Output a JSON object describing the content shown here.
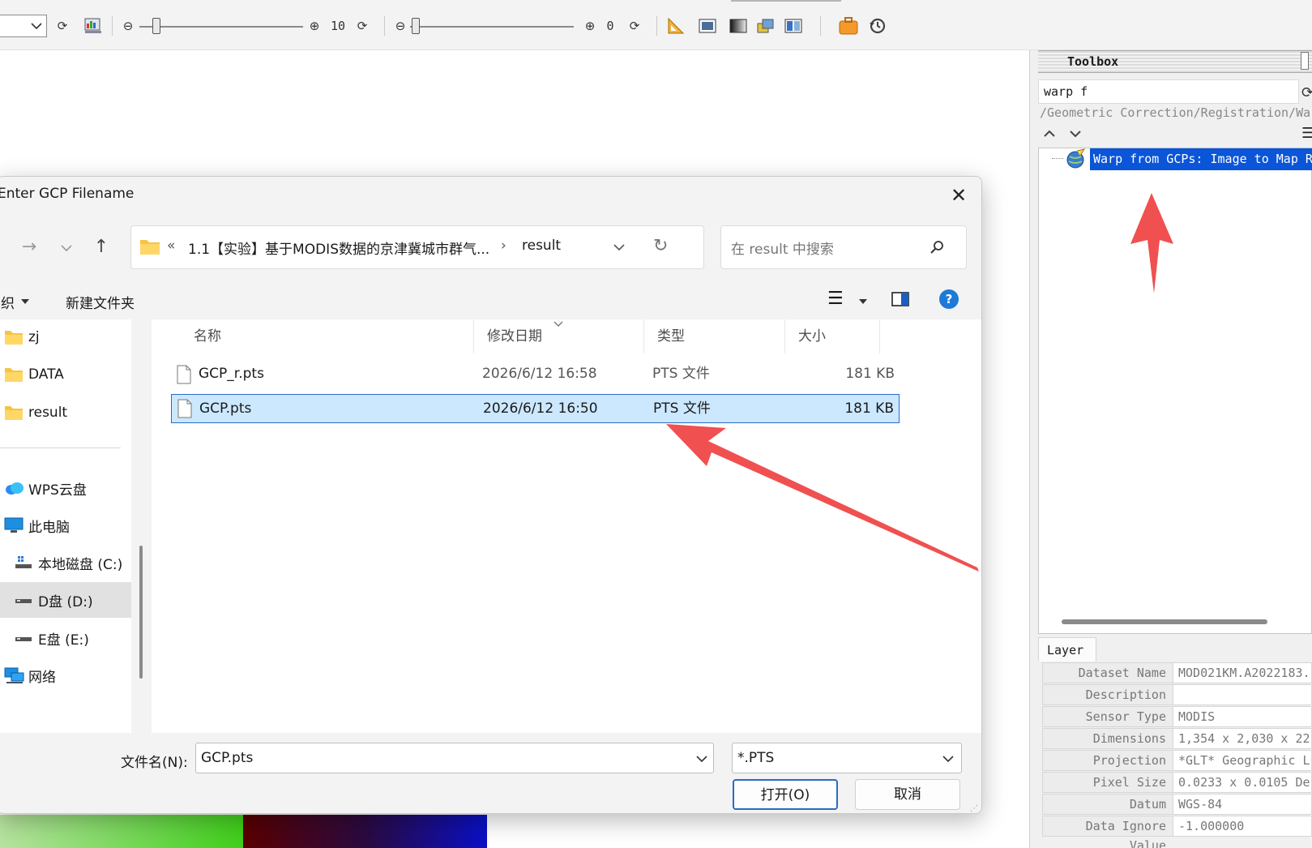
{
  "toolbar": {
    "slider1_value": "10",
    "slider2_value": "0",
    "minus": "⊖",
    "plus": "⊕",
    "refresh": "⟳"
  },
  "toolbox": {
    "title": "Toolbox",
    "search_value": "warp f",
    "path": "/Geometric Correction/Registration/Warp",
    "tree_item": "Warp from GCPs: Image to Map Re"
  },
  "layer": {
    "tab": "Layer",
    "rows": [
      {
        "key": "Dataset Name",
        "value": "MOD021KM.A2022183."
      },
      {
        "key": "Description",
        "value": ""
      },
      {
        "key": "Sensor Type",
        "value": "MODIS"
      },
      {
        "key": "Dimensions",
        "value": "1,354 x 2,030 x 22"
      },
      {
        "key": "Projection",
        "value": "*GLT* Geographic L"
      },
      {
        "key": "Pixel Size",
        "value": "0.0233 x 0.0105 De"
      },
      {
        "key": "Datum",
        "value": "WGS-84"
      },
      {
        "key": "Data Ignore Value",
        "value": "-1.000000"
      }
    ]
  },
  "dialog": {
    "title": "Enter GCP Filename",
    "breadcrumb_prefix": "«",
    "breadcrumb_folder": "1.1【实验】基于MODIS数据的京津冀城市群气...",
    "breadcrumb_current": "result",
    "search_placeholder": "在 result 中搜索",
    "organize": "织",
    "new_folder": "新建文件夹",
    "nav_items": [
      {
        "label": "zj",
        "icon": "folder-icon"
      },
      {
        "label": "DATA",
        "icon": "folder-icon"
      },
      {
        "label": "result",
        "icon": "folder-icon"
      },
      {
        "label": "WPS云盘",
        "icon": "cloud-icon"
      },
      {
        "label": "此电脑",
        "icon": "computer-icon"
      },
      {
        "label": "本地磁盘 (C:)",
        "icon": "drive-icon"
      },
      {
        "label": "D盘 (D:)",
        "icon": "drive-icon"
      },
      {
        "label": "E盘 (E:)",
        "icon": "drive-icon"
      },
      {
        "label": "网络",
        "icon": "network-icon"
      }
    ],
    "columns": {
      "name": "名称",
      "date": "修改日期",
      "type": "类型",
      "size": "大小"
    },
    "files": [
      {
        "name": "GCP_r.pts",
        "date": "2026/6/12 16:58",
        "type": "PTS 文件",
        "size": "181 KB"
      },
      {
        "name": "GCP.pts",
        "date": "2026/6/12 16:50",
        "type": "PTS 文件",
        "size": "181 KB"
      }
    ],
    "filename_label": "文件名(N):",
    "filename_value": "GCP.pts",
    "filter_value": "*.PTS",
    "open_button": "打开(O)",
    "cancel_button": "取消"
  },
  "colors": {
    "accent": "#0a55d8",
    "selection": "#cce8ff",
    "arrow": "#f05050",
    "folder": "#f6c342"
  }
}
